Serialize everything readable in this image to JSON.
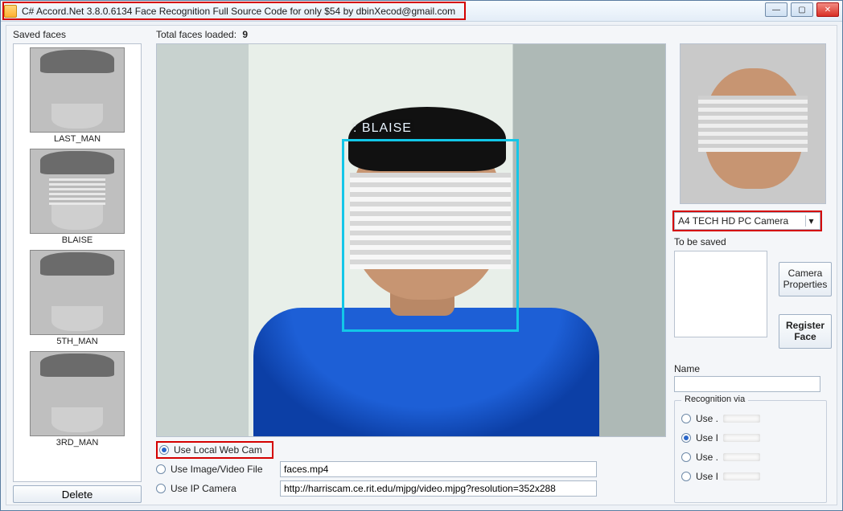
{
  "window": {
    "title": "C# Accord.Net 3.8.0.6134 Face Recognition Full Source Code for only $54 by dbinXecod@gmail.com"
  },
  "labels": {
    "saved_faces": "Saved faces",
    "total_faces_prefix": "Total faces loaded:",
    "total_faces_count": "9",
    "to_be_saved": "To be saved",
    "name": "Name",
    "recognition_via": "Recognition via"
  },
  "saved_list": [
    {
      "caption": "LAST_MAN",
      "censored": false
    },
    {
      "caption": "BLAISE",
      "censored": true
    },
    {
      "caption": "5TH_MAN",
      "censored": false
    },
    {
      "caption": "3RD_MAN",
      "censored": false
    }
  ],
  "buttons": {
    "delete": "Delete",
    "camera_properties": "Camera Properties",
    "register_face": "Register Face"
  },
  "video": {
    "detected_label": ": BLAISE"
  },
  "source": {
    "options": {
      "local_webcam": "Use Local Web Cam",
      "image_video": "Use Image/Video File",
      "ip_camera": "Use IP Camera"
    },
    "selected": "local_webcam",
    "image_video_value": "faces.mp4",
    "ip_camera_value": "http://harriscam.ce.rit.edu/mjpg/video.mjpg?resolution=352x288"
  },
  "camera_select": {
    "value": "A4 TECH HD PC Camera"
  },
  "recognition_options": {
    "opt1_prefix": "Use .",
    "opt2_prefix": "Use I",
    "opt3_prefix": "Use .",
    "opt4_prefix": "Use I",
    "selected_index": 1
  }
}
